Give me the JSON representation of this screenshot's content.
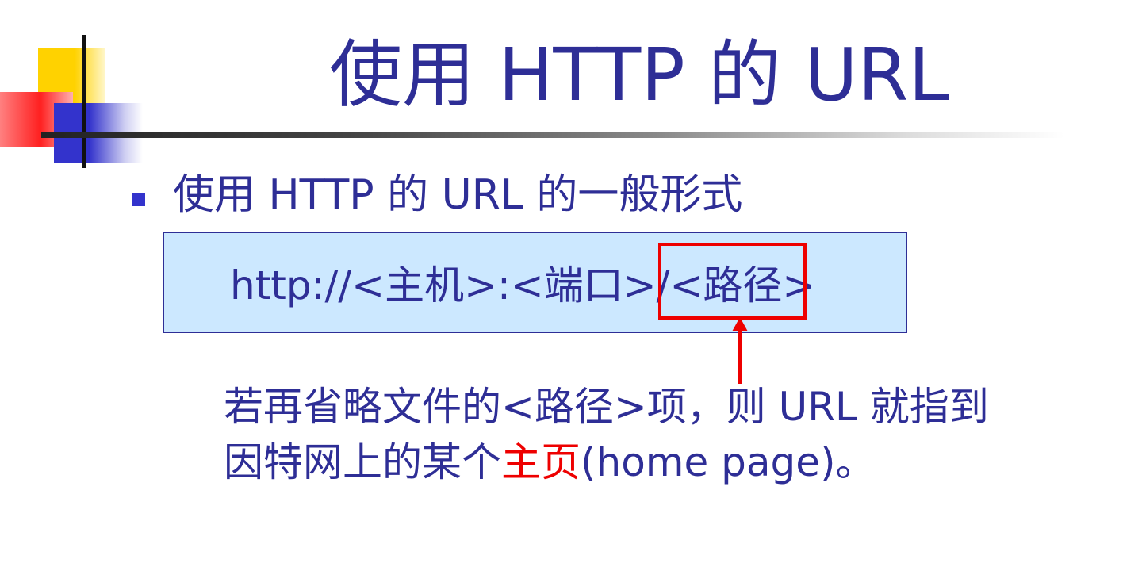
{
  "slide": {
    "title": "使用 HTTP 的 URL",
    "bullet": "使用 HTTP 的 URL 的一般形式",
    "url_format": "http://<主机>:<端口>/<路径>",
    "note": {
      "line1": "若再省略文件的<路径>项，则 URL 就指到",
      "line2_prefix": "因特网上的某个",
      "line2_highlight": "主页",
      "line2_suffix": "(home page)。"
    }
  },
  "colors": {
    "text": "#2e2e96",
    "highlight": "#ee0000",
    "box_background": "#cce8ff",
    "bullet": "#3333cc"
  }
}
